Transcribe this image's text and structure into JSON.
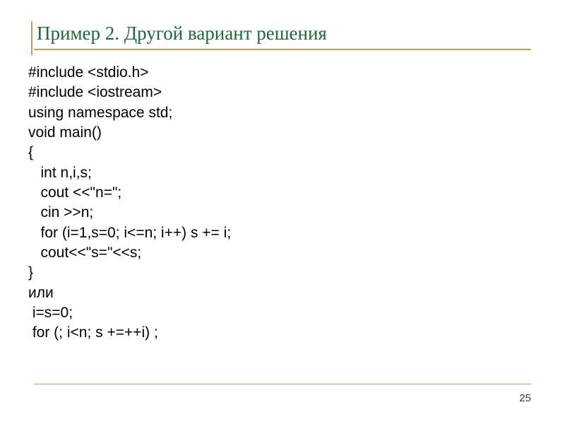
{
  "title": "Пример 2. Другой вариант решения",
  "code_lines": [
    "#include <stdio.h>",
    "#include <iostream>",
    "using namespace std;",
    "void main()",
    "{",
    "   int n,i,s;",
    "   cout <<\"n=\";",
    "   cin >>n;",
    "   for (i=1,s=0; i<=n; i++) s += i;",
    "   cout<<\"s=\"<<s;",
    "}",
    "или",
    " i=s=0;",
    " for (; i<n; s +=++i) ;"
  ],
  "page_number": "25"
}
